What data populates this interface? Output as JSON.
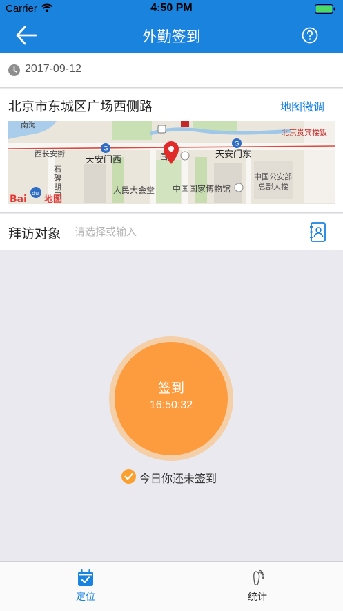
{
  "status_bar": {
    "carrier": "Carrier",
    "time": "4:50 PM"
  },
  "nav": {
    "title": "外勤签到",
    "back_icon": "back-arrow-icon",
    "help_icon": "question-circle-icon"
  },
  "date_row": {
    "date": "2017-09-12",
    "icon": "clock-icon"
  },
  "location": {
    "address": "北京市东城区广场西侧路",
    "adjust_label": "地图微调",
    "map": {
      "labels": {
        "nanhai": "南海",
        "xichanganjie": "西长安街",
        "tiananmen_west": "天安门西",
        "tiananmen_east": "天安门东",
        "shibeihutong": "石\n碑\n胡\n同",
        "great_hall": "人民大会堂",
        "national_museum": "中国国家博物馆",
        "ministry": "中国公安部\n总部大楼",
        "guibin": "北京贵宾楼饭",
        "guobo_fragment": "国",
        "baidu_logo": "Bai",
        "baidu_du": "du",
        "baidu_map": "地图"
      }
    }
  },
  "visit": {
    "label": "拜访对象",
    "placeholder": "请选择或输入",
    "contact_icon": "contact-book-icon"
  },
  "checkin": {
    "label": "签到",
    "clock": "16:50:32"
  },
  "status_note": {
    "text": "今日你还未签到",
    "icon": "check-circle-icon"
  },
  "tabs": [
    {
      "label": "定位",
      "icon": "calendar-check-icon",
      "active": true
    },
    {
      "label": "统计",
      "icon": "footprint-icon",
      "active": false
    }
  ],
  "colors": {
    "primary": "#1a83de",
    "orange": "#fd9c3e",
    "orange_ring": "#f4cfa7",
    "background": "#e9e9ef"
  }
}
